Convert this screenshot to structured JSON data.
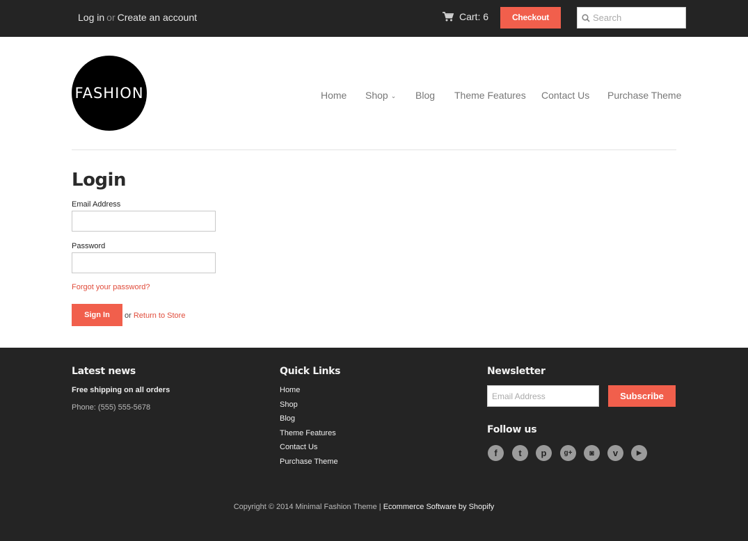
{
  "topbar": {
    "login": "Log in",
    "or": "or",
    "create_account": "Create an account",
    "cart_label": "Cart: 6",
    "checkout": "Checkout",
    "search_placeholder": "Search",
    "cart_icon": "cart-icon",
    "search_icon": "search-icon"
  },
  "header": {
    "logo_text": "FASHION",
    "nav": [
      "Home",
      "Shop",
      "Blog",
      "Theme Features",
      "Contact Us",
      "Purchase Theme"
    ]
  },
  "login": {
    "title": "Login",
    "email_label": "Email Address",
    "email_value": "",
    "password_label": "Password",
    "password_value": "",
    "forgot": "Forgot your password?",
    "sign_in": "Sign In",
    "or": "or",
    "return": "Return to Store"
  },
  "footer": {
    "news_heading": "Latest news",
    "news_bold": "Free shipping on all orders",
    "news_phone": "Phone: (555) 555-5678",
    "links_heading": "Quick Links",
    "links": [
      "Home",
      "Shop",
      "Blog",
      "Theme Features",
      "Contact Us",
      "Purchase Theme"
    ],
    "newsletter_heading": "Newsletter",
    "newsletter_placeholder": "Email Address",
    "subscribe": "Subscribe",
    "follow_heading": "Follow us",
    "social": [
      {
        "icon": "facebook-icon",
        "glyph": "f"
      },
      {
        "icon": "twitter-icon",
        "glyph": "t"
      },
      {
        "icon": "pinterest-icon",
        "glyph": "p"
      },
      {
        "icon": "google-plus-icon",
        "glyph": "g+"
      },
      {
        "icon": "instagram-icon",
        "glyph": "◙"
      },
      {
        "icon": "vimeo-icon",
        "glyph": "v"
      },
      {
        "icon": "youtube-icon",
        "glyph": "▶"
      }
    ],
    "copyright": "Copyright © 2014 Minimal Fashion Theme |",
    "shopify": "Ecommerce Software by Shopify"
  },
  "colors": {
    "accent": "#f15f4c",
    "link": "#e04b3a",
    "dark": "#242424"
  }
}
